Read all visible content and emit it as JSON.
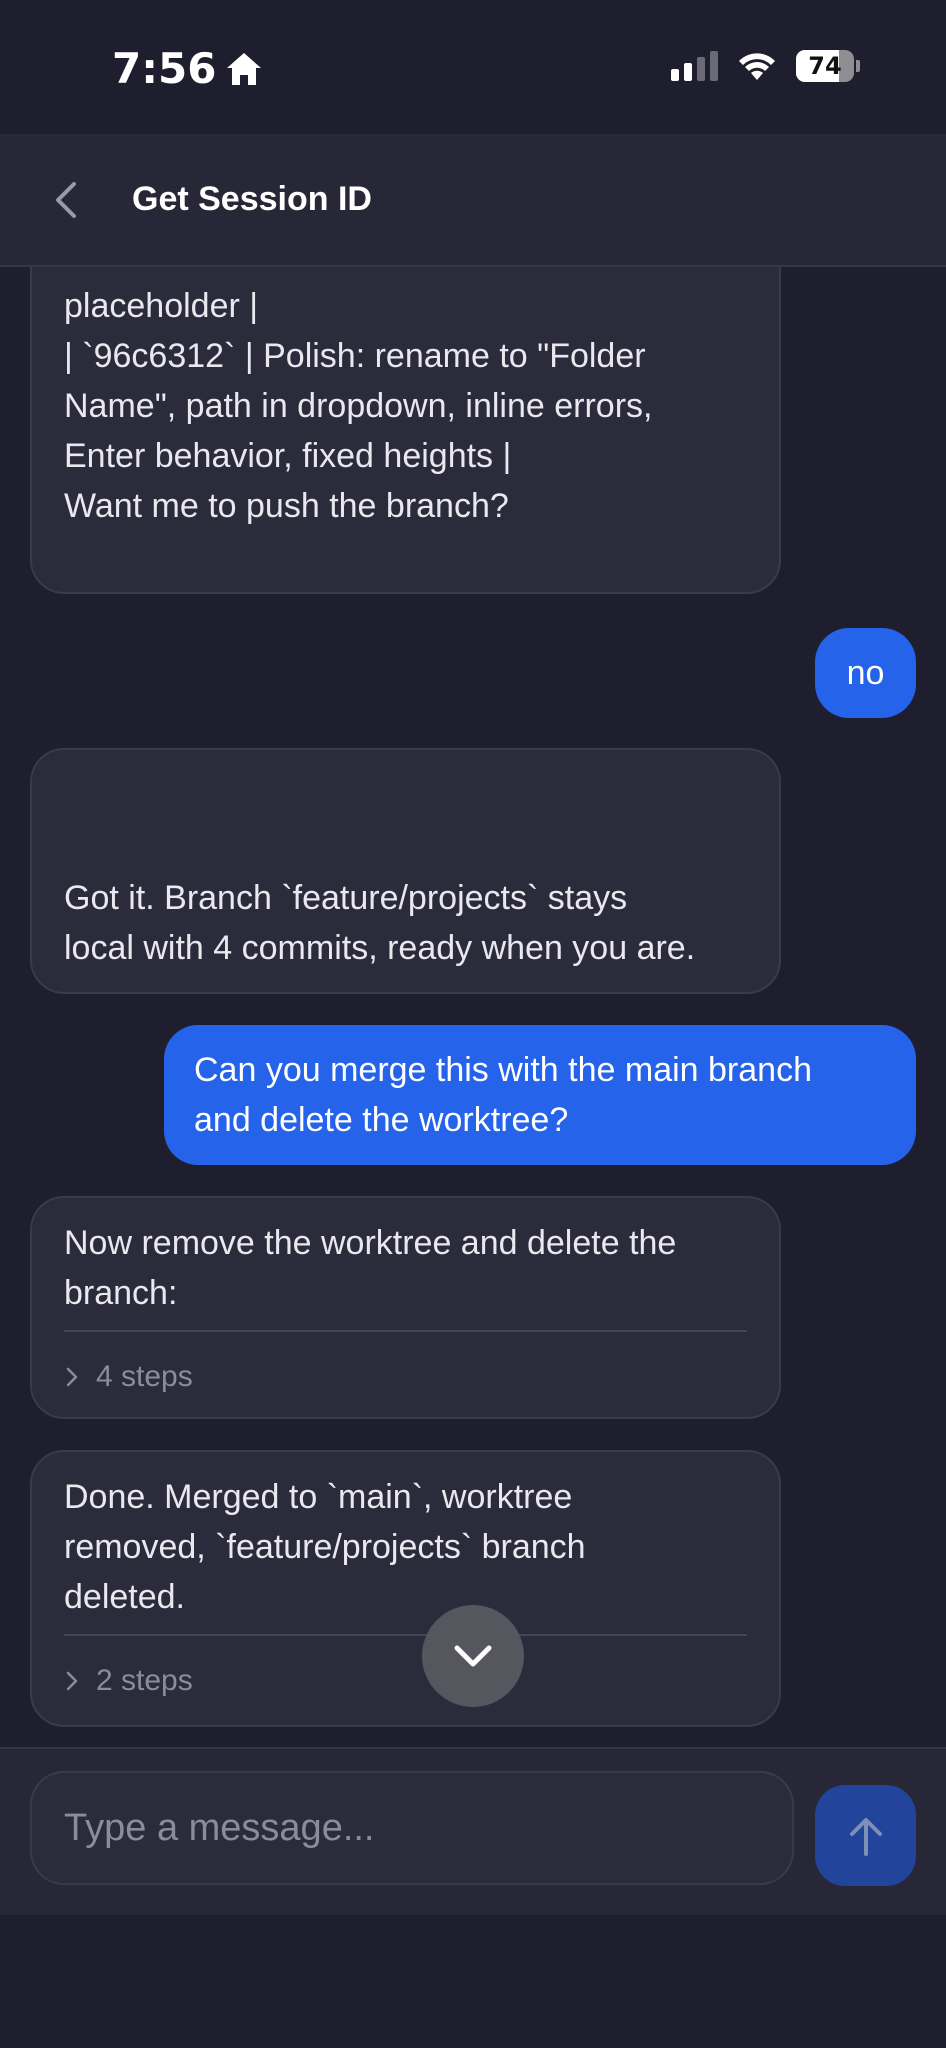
{
  "status_bar": {
    "time": "7:56",
    "battery": "74",
    "home_icon": "home-icon",
    "signal_icon": "cellular-signal-icon",
    "wifi_icon": "wifi-icon"
  },
  "header": {
    "title": "Get Session ID",
    "back_icon": "chevron-left-icon"
  },
  "messages": [
    {
      "role": "assistant",
      "lines": [
        "placeholder |",
        "| `96c6312` | Polish: rename to \"Folder",
        "Name\", path in dropdown, inline errors,",
        "Enter behavior, fixed heights |",
        "",
        "Want me to push the branch?"
      ]
    },
    {
      "role": "user",
      "lines": [
        "no"
      ]
    },
    {
      "role": "assistant",
      "lines": [
        "Got it. Branch `feature/projects` stays",
        "local with 4 commits, ready when you are."
      ]
    },
    {
      "role": "user",
      "lines": [
        "Can you merge this with the main branch",
        "and delete the worktree?"
      ]
    },
    {
      "role": "assistant",
      "lines": [
        "Now remove the worktree and delete the",
        "branch:"
      ],
      "steps": "4 steps"
    },
    {
      "role": "assistant",
      "lines": [
        "Done. Merged to `main`, worktree",
        "removed, `feature/projects` branch",
        "deleted."
      ],
      "steps": "2 steps"
    }
  ],
  "scroll_down_icon": "chevron-down-icon",
  "composer": {
    "placeholder": "Type a message...",
    "send_icon": "arrow-up-icon"
  },
  "colors": {
    "background": "#1e1e2e",
    "surface": "#2b2b3c",
    "user_bubble": "#2563eb",
    "send_button": "#22449a"
  }
}
